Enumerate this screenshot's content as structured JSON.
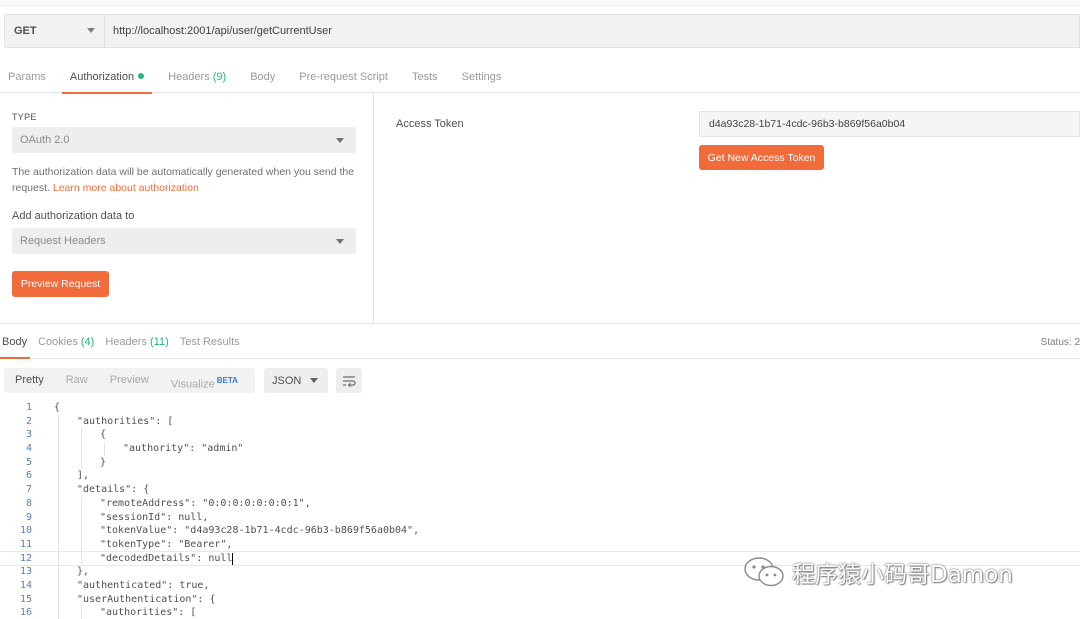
{
  "request": {
    "method": "GET",
    "url": "http://localhost:2001/api/user/getCurrentUser"
  },
  "request_tabs": [
    {
      "label": "Params"
    },
    {
      "label": "Authorization",
      "active": true,
      "dot": true
    },
    {
      "label": "Headers",
      "count": "(9)"
    },
    {
      "label": "Body"
    },
    {
      "label": "Pre-request Script"
    },
    {
      "label": "Tests"
    },
    {
      "label": "Settings"
    }
  ],
  "auth": {
    "type_label": "TYPE",
    "type_value": "OAuth 2.0",
    "description": "The authorization data will be automatically generated when you send the request.",
    "learn_more_link": "Learn more about authorization",
    "add_to_label": "Add authorization data to",
    "add_to_value": "Request Headers",
    "preview_button": "Preview Request",
    "access_token_label": "Access Token",
    "access_token_value": "d4a93c28-1b71-4cdc-96b3-b869f56a0b04",
    "get_token_button": "Get New Access Token"
  },
  "response_tabs": [
    {
      "label": "Body",
      "active": true
    },
    {
      "label": "Cookies",
      "count": "(4)"
    },
    {
      "label": "Headers",
      "count": "(11)"
    },
    {
      "label": "Test Results"
    }
  ],
  "status_text": "Status: 2",
  "view_modes": [
    {
      "label": "Pretty",
      "active": true
    },
    {
      "label": "Raw"
    },
    {
      "label": "Preview"
    },
    {
      "label": "Visualize",
      "badge": "BETA"
    }
  ],
  "format": "JSON",
  "code_lines": [
    {
      "n": "1",
      "indent": 0,
      "text": "{"
    },
    {
      "n": "2",
      "indent": 1,
      "text": "\"authorities\": ["
    },
    {
      "n": "3",
      "indent": 2,
      "text": "{"
    },
    {
      "n": "4",
      "indent": 3,
      "text": "\"authority\": \"admin\""
    },
    {
      "n": "5",
      "indent": 2,
      "text": "}"
    },
    {
      "n": "6",
      "indent": 1,
      "text": "],"
    },
    {
      "n": "7",
      "indent": 1,
      "text": "\"details\": {"
    },
    {
      "n": "8",
      "indent": 2,
      "text": "\"remoteAddress\": \"0:0:0:0:0:0:0:1\","
    },
    {
      "n": "9",
      "indent": 2,
      "text": "\"sessionId\": null,"
    },
    {
      "n": "10",
      "indent": 2,
      "text": "\"tokenValue\": \"d4a93c28-1b71-4cdc-96b3-b869f56a0b04\","
    },
    {
      "n": "11",
      "indent": 2,
      "text": "\"tokenType\": \"Bearer\","
    },
    {
      "n": "12",
      "indent": 2,
      "text": "\"decodedDetails\": null",
      "current": true
    },
    {
      "n": "13",
      "indent": 1,
      "text": "},"
    },
    {
      "n": "14",
      "indent": 1,
      "text": "\"authenticated\": true,"
    },
    {
      "n": "15",
      "indent": 1,
      "text": "\"userAuthentication\": {"
    },
    {
      "n": "16",
      "indent": 2,
      "text": "\"authorities\": ["
    }
  ],
  "watermark": "程序猿小码哥Damon",
  "colors": {
    "accent": "#f26b3a",
    "count_green": "#26b47f",
    "beta_blue": "#3a7bd5",
    "json_key": "#1a4a9c"
  }
}
